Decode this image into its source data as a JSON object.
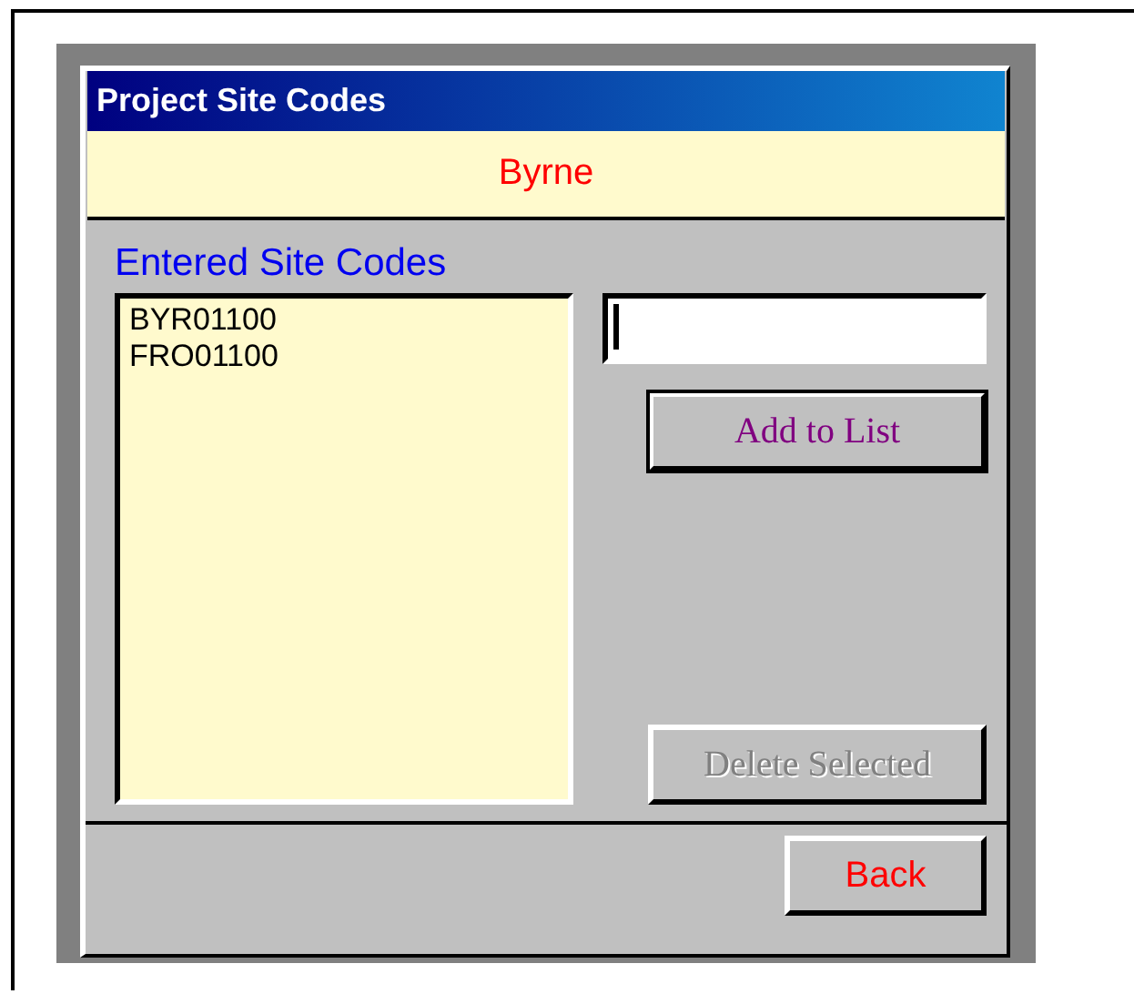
{
  "window": {
    "title": "Project Site Codes"
  },
  "header": {
    "text": "Byrne"
  },
  "list": {
    "label": "Entered Site Codes",
    "items": [
      {
        "text": "BYR01100",
        "selected": false
      },
      {
        "text": "FRO01100",
        "selected": false
      }
    ]
  },
  "entry": {
    "focused": true
  },
  "buttons": [
    {
      "label": "Add to List",
      "kind": "add",
      "disabled": false
    },
    {
      "label": "Delete Selected",
      "kind": "delete",
      "disabled": true
    },
    {
      "label": "Back",
      "kind": "back",
      "disabled": false
    }
  ]
}
